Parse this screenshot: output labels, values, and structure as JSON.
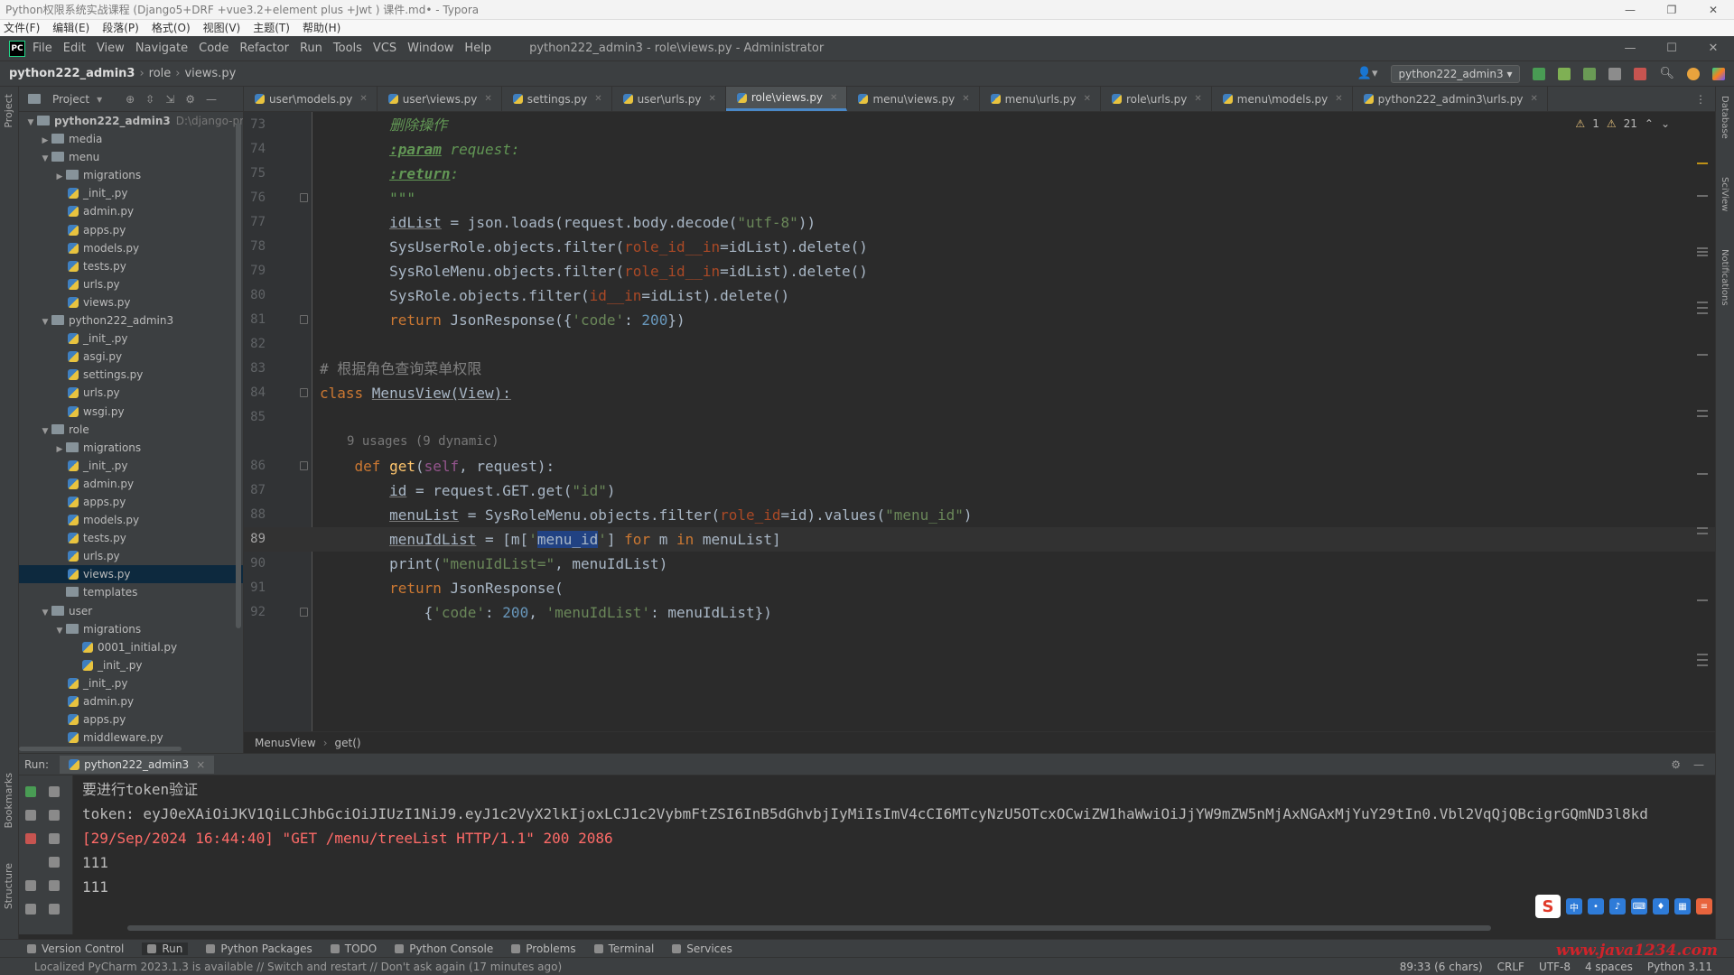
{
  "typora": {
    "title": "Python权限系统实战课程 (Django5+DRF +vue3.2+element plus +Jwt ) 课件.md• - Typora",
    "menu": [
      "文件(F)",
      "编辑(E)",
      "段落(P)",
      "格式(O)",
      "视图(V)",
      "主题(T)",
      "帮助(H)"
    ]
  },
  "pycharm": {
    "menu": [
      "File",
      "Edit",
      "View",
      "Navigate",
      "Code",
      "Refactor",
      "Run",
      "Tools",
      "VCS",
      "Window",
      "Help"
    ],
    "title": "python222_admin3 - role\\views.py - Administrator",
    "breadcrumb": [
      "python222_admin3",
      "role",
      "views.py"
    ],
    "run_config": "python222_admin3"
  },
  "project": {
    "header": "Project",
    "tree": [
      {
        "label": "python222_admin3",
        "type": "root",
        "level": 0,
        "hint": "D:\\django-pr"
      },
      {
        "label": "media",
        "type": "folder",
        "level": 1,
        "collapsed": true
      },
      {
        "label": "menu",
        "type": "folder",
        "level": 1
      },
      {
        "label": "migrations",
        "type": "folder",
        "level": 2,
        "collapsed": true
      },
      {
        "label": "_init_.py",
        "type": "py",
        "level": 3
      },
      {
        "label": "admin.py",
        "type": "py",
        "level": 3
      },
      {
        "label": "apps.py",
        "type": "py",
        "level": 3
      },
      {
        "label": "models.py",
        "type": "py",
        "level": 3
      },
      {
        "label": "tests.py",
        "type": "py",
        "level": 3
      },
      {
        "label": "urls.py",
        "type": "py",
        "level": 3
      },
      {
        "label": "views.py",
        "type": "py",
        "level": 3
      },
      {
        "label": "python222_admin3",
        "type": "folder",
        "level": 1
      },
      {
        "label": "_init_.py",
        "type": "py",
        "level": 3
      },
      {
        "label": "asgi.py",
        "type": "py",
        "level": 3
      },
      {
        "label": "settings.py",
        "type": "py",
        "level": 3
      },
      {
        "label": "urls.py",
        "type": "py",
        "level": 3
      },
      {
        "label": "wsgi.py",
        "type": "py",
        "level": 3
      },
      {
        "label": "role",
        "type": "folder",
        "level": 1
      },
      {
        "label": "migrations",
        "type": "folder",
        "level": 2,
        "collapsed": true
      },
      {
        "label": "_init_.py",
        "type": "py",
        "level": 3
      },
      {
        "label": "admin.py",
        "type": "py",
        "level": 3
      },
      {
        "label": "apps.py",
        "type": "py",
        "level": 3
      },
      {
        "label": "models.py",
        "type": "py",
        "level": 3
      },
      {
        "label": "tests.py",
        "type": "py",
        "level": 3
      },
      {
        "label": "urls.py",
        "type": "py",
        "level": 3
      },
      {
        "label": "views.py",
        "type": "py",
        "level": 3,
        "selected": true
      },
      {
        "label": "templates",
        "type": "folder",
        "level": 2,
        "noarrow": true
      },
      {
        "label": "user",
        "type": "folder",
        "level": 1
      },
      {
        "label": "migrations",
        "type": "folder",
        "level": 2
      },
      {
        "label": "0001_initial.py",
        "type": "py",
        "level": 4
      },
      {
        "label": "_init_.py",
        "type": "py",
        "level": 4
      },
      {
        "label": "_init_.py",
        "type": "py",
        "level": 3
      },
      {
        "label": "admin.py",
        "type": "py",
        "level": 3
      },
      {
        "label": "apps.py",
        "type": "py",
        "level": 3
      },
      {
        "label": "middleware.py",
        "type": "py",
        "level": 3
      }
    ]
  },
  "tabs": [
    {
      "label": "user\\models.py"
    },
    {
      "label": "user\\views.py"
    },
    {
      "label": "settings.py"
    },
    {
      "label": "user\\urls.py"
    },
    {
      "label": "role\\views.py",
      "active": true
    },
    {
      "label": "menu\\views.py"
    },
    {
      "label": "menu\\urls.py"
    },
    {
      "label": "role\\urls.py"
    },
    {
      "label": "menu\\models.py"
    },
    {
      "label": "python222_admin3\\urls.py"
    }
  ],
  "editor": {
    "warnings": {
      "warn_count": "1",
      "weak_count": "21"
    },
    "inlay_hint": "9 usages (9 dynamic)",
    "current_line": "89",
    "lines": [
      {
        "n": "73",
        "tokens": [
          [
            "doc",
            "        删除操作"
          ]
        ]
      },
      {
        "n": "74",
        "tokens": [
          [
            "doc",
            "        "
          ],
          [
            "doctag",
            ":param"
          ],
          [
            "doc",
            " request:"
          ]
        ]
      },
      {
        "n": "75",
        "tokens": [
          [
            "doc",
            "        "
          ],
          [
            "doctag",
            ":return"
          ],
          [
            "doc",
            ":"
          ]
        ]
      },
      {
        "n": "76",
        "fold": true,
        "tokens": [
          [
            "doc",
            "        \"\"\""
          ]
        ]
      },
      {
        "n": "77",
        "tokens": [
          [
            "",
            "        "
          ],
          [
            "ul",
            "idList"
          ],
          [
            "",
            " = json.loads(request.body.decode("
          ],
          [
            "str",
            "\"utf-8\""
          ],
          [
            "",
            "))"
          ]
        ]
      },
      {
        "n": "78",
        "tokens": [
          [
            "",
            "        SysUserRole.objects.filter("
          ],
          [
            "par",
            "role_id__in"
          ],
          [
            "",
            "=idList).delete()"
          ]
        ]
      },
      {
        "n": "79",
        "tokens": [
          [
            "",
            "        SysRoleMenu.objects.filter("
          ],
          [
            "par",
            "role_id__in"
          ],
          [
            "",
            "=idList).delete()"
          ]
        ]
      },
      {
        "n": "80",
        "tokens": [
          [
            "",
            "        SysRole.objects.filter("
          ],
          [
            "par",
            "id__in"
          ],
          [
            "",
            "=idList).delete()"
          ]
        ]
      },
      {
        "n": "81",
        "fold": true,
        "tokens": [
          [
            "kw",
            "        return "
          ],
          [
            "",
            "JsonResponse({"
          ],
          [
            "str",
            "'code'"
          ],
          [
            "",
            ": "
          ],
          [
            "num",
            "200"
          ],
          [
            "",
            "})"
          ]
        ]
      },
      {
        "n": "82",
        "tokens": []
      },
      {
        "n": "83",
        "tokens": [
          [
            "cmt",
            "# 根据角色查询菜单权限"
          ]
        ]
      },
      {
        "n": "84",
        "fold": true,
        "tokens": [
          [
            "kw",
            "class "
          ],
          [
            "ul",
            "MenusView(View):"
          ]
        ]
      },
      {
        "n": "85",
        "tokens": []
      },
      {
        "n": "",
        "hint": true
      },
      {
        "n": "86",
        "fold": true,
        "tokens": [
          [
            "kw",
            "    def "
          ],
          [
            "fn",
            "get"
          ],
          [
            "",
            "("
          ],
          [
            "self",
            "self"
          ],
          [
            "",
            ", request):"
          ]
        ]
      },
      {
        "n": "87",
        "tokens": [
          [
            "",
            "        "
          ],
          [
            "ul",
            "id"
          ],
          [
            "",
            " = request.GET.get("
          ],
          [
            "str",
            "\"id\""
          ],
          [
            "",
            ")"
          ]
        ]
      },
      {
        "n": "88",
        "tokens": [
          [
            "",
            "        "
          ],
          [
            "ul",
            "menuList"
          ],
          [
            "",
            " = SysRoleMenu.objects.filter("
          ],
          [
            "par",
            "role_id"
          ],
          [
            "",
            "=id).values("
          ],
          [
            "str",
            "\"menu_id\""
          ],
          [
            "",
            ")"
          ]
        ]
      },
      {
        "n": "89",
        "current": true,
        "tokens": [
          [
            "",
            "        "
          ],
          [
            "ul",
            "menuIdList"
          ],
          [
            "",
            " = [m["
          ],
          [
            "str",
            "'"
          ],
          [
            "sel",
            "menu_id"
          ],
          [
            "str",
            "'"
          ],
          [
            "",
            "] "
          ],
          [
            "kw",
            "for"
          ],
          [
            "",
            " m "
          ],
          [
            "kw",
            "in"
          ],
          [
            "",
            " menuList]"
          ]
        ]
      },
      {
        "n": "90",
        "tokens": [
          [
            "",
            "        print("
          ],
          [
            "str",
            "\"menuIdList=\""
          ],
          [
            "",
            ", menuIdList)"
          ]
        ]
      },
      {
        "n": "91",
        "tokens": [
          [
            "kw",
            "        return "
          ],
          [
            "",
            "JsonResponse("
          ]
        ]
      },
      {
        "n": "92",
        "fold": true,
        "tokens": [
          [
            "",
            "            {"
          ],
          [
            "str",
            "'code'"
          ],
          [
            "",
            ": "
          ],
          [
            "num",
            "200"
          ],
          [
            "",
            ", "
          ],
          [
            "str",
            "'menuIdList'"
          ],
          [
            "",
            ": menuIdList})"
          ]
        ]
      }
    ]
  },
  "editor_breadcrumb": [
    "MenusView",
    "get()"
  ],
  "run": {
    "label": "Run:",
    "tab": "python222_admin3",
    "console": [
      {
        "text": "要进行token验证",
        "color": "normal"
      },
      {
        "text": "token: eyJ0eXAiOiJKV1QiLCJhbGciOiJIUzI1NiJ9.eyJ1c2VyX2lkIjoxLCJ1c2VybmFtZSI6InB5dGhvbjIyMiIsImV4cCI6MTcyNzU5OTcxOCwiZW1haWwiOiJjYW9mZW5nMjAxNGAxMjYuY29tIn0.Vbl2VqQjQBcigrGQmND3l8kd",
        "color": "normal"
      },
      {
        "text": "[29/Sep/2024 16:44:40] \"GET /menu/treeList HTTP/1.1\" 200 2086",
        "color": "red"
      },
      {
        "text": "111",
        "color": "normal"
      },
      {
        "text": "111",
        "color": "normal"
      }
    ]
  },
  "side_labels": {
    "left": [
      "Project",
      "Bookmarks",
      "Structure"
    ],
    "right": [
      "Database",
      "SciView",
      "Notifications"
    ]
  },
  "ime": {
    "sogou": "S",
    "lang": "中"
  },
  "bottom_tools": [
    "Version Control",
    "Run",
    "Python Packages",
    "TODO",
    "Python Console",
    "Problems",
    "Terminal",
    "Services"
  ],
  "status": {
    "message": "Localized PyCharm 2023.1.3 is available // Switch and restart // Don't ask again (17 minutes ago)",
    "right": [
      "89:33 (6 chars)",
      "CRLF",
      "UTF-8",
      "4 spaces",
      "Python 3.11"
    ]
  },
  "watermark": "www.java1234.com",
  "colors": {
    "accent": "#4a88c7",
    "keyword": "#cc7832",
    "string": "#6a8759",
    "number": "#6897bb",
    "error": "#ff6b68"
  }
}
